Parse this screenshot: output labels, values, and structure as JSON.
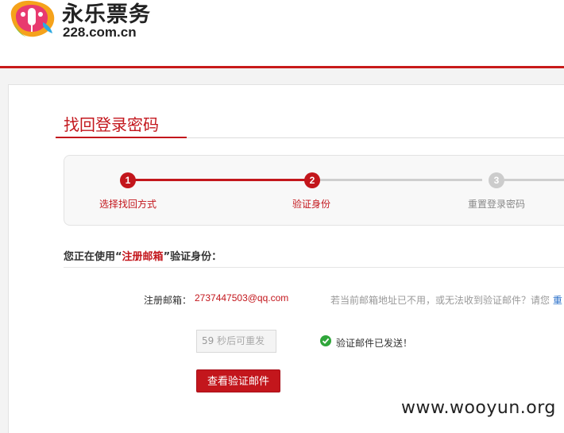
{
  "header": {
    "logo_text": "永乐票务",
    "logo_domain": "228.com.cn",
    "logo_icon": "microphone-logo-icon"
  },
  "main": {
    "title": "找回登录密码",
    "steps": [
      {
        "number": "1",
        "label": "选择找回方式",
        "state": "done"
      },
      {
        "number": "2",
        "label": "验证身份",
        "state": "active"
      },
      {
        "number": "3",
        "label": "重置登录密码",
        "state": "pending"
      }
    ],
    "identity": {
      "prefix": "您正在使用“",
      "highlight": "注册邮箱",
      "suffix": "”验证身份："
    },
    "email_label": "注册邮箱：",
    "email_value": "2737447503@qq.com",
    "help_text": "若当前邮箱地址已不用，或无法收到验证邮件？请您 ",
    "help_link": "重",
    "countdown_number": "59",
    "countdown_text": "秒后可重发",
    "sent_text": "验证邮件已发送！",
    "sent_icon": "check-circle-icon",
    "view_mail_button": "查看验证邮件"
  },
  "watermark": "www.wooyun.org",
  "colors": {
    "brand_red": "#c3161c",
    "success_green": "#2fa63a",
    "link_blue": "#2a6fc9"
  }
}
